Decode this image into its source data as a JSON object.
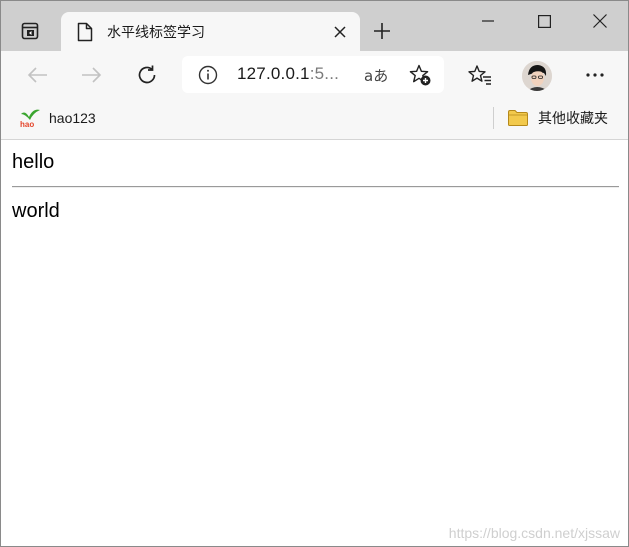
{
  "tab": {
    "title": "水平线标签学习"
  },
  "address_bar": {
    "url_main": "127.0.0.1",
    "url_tail": ":5...",
    "read_aloud": "aあ"
  },
  "bookmarks": {
    "left_label": "hao123",
    "left_logo": "hao",
    "right_label": "其他收藏夹"
  },
  "page": {
    "line1": "hello",
    "line2": "world"
  },
  "watermark": "https://blog.csdn.net/xjssaw",
  "icons": {
    "workspaces": "workspaces-icon",
    "document": "document-icon",
    "close": "close-icon",
    "new_tab": "plus-icon",
    "minimize": "minimize-icon",
    "maximize": "maximize-icon",
    "close_window": "close-window-icon",
    "back": "back-arrow-icon",
    "forward": "forward-arrow-icon",
    "refresh": "refresh-icon",
    "info": "info-icon",
    "add_favorite": "add-favorite-icon",
    "favorites": "favorites-icon",
    "profile": "avatar",
    "more": "more-icon",
    "folder": "folder-icon"
  },
  "colors": {
    "folder": "#f2c94c",
    "hao_green": "#3aa52f",
    "hao_red": "#e4452b"
  }
}
